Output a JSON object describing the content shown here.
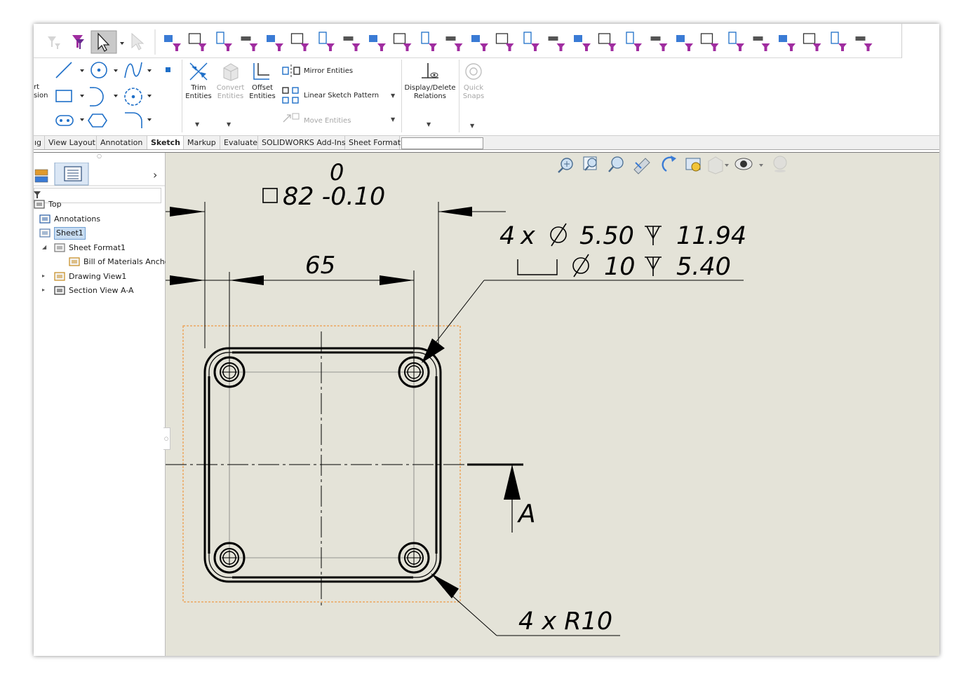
{
  "ribbon": {
    "left_partial_labels": [
      "rt",
      "sion"
    ],
    "trim_label": [
      "Trim",
      "Entities"
    ],
    "convert_label": [
      "Convert",
      "Entities"
    ],
    "offset_label": [
      "Offset",
      "Entities"
    ],
    "mirror_label": "Mirror Entities",
    "linear_pattern_label": "Linear Sketch Pattern",
    "move_label": "Move Entities",
    "relations_label": [
      "Display/Delete",
      "Relations"
    ],
    "quick_snaps_label": [
      "Quick",
      "Snaps"
    ]
  },
  "tabs": [
    {
      "label": "ıg",
      "active": false
    },
    {
      "label": "View Layout",
      "active": false
    },
    {
      "label": "Annotation",
      "active": false
    },
    {
      "label": "Sketch",
      "active": true
    },
    {
      "label": "Markup",
      "active": false
    },
    {
      "label": "Evaluate",
      "active": false
    },
    {
      "label": "SOLIDWORKS Add-Ins",
      "active": false
    },
    {
      "label": "Sheet Format",
      "active": false
    }
  ],
  "tree": {
    "items": [
      {
        "label": "Top",
        "icon": "drawing-icon"
      },
      {
        "label": "Annotations",
        "icon": "annotations-icon"
      },
      {
        "label": "Sheet1",
        "icon": "sheet-icon",
        "selected": true
      },
      {
        "label": "Sheet Format1",
        "icon": "sheet-format-icon",
        "expanded": true
      },
      {
        "label": "Bill of Materials Anchor",
        "icon": "bom-anchor-icon"
      },
      {
        "label": "Drawing View1",
        "icon": "drawing-view-icon",
        "expanded": false
      },
      {
        "label": "Section View A-A",
        "icon": "section-view-icon",
        "expanded": false
      }
    ],
    "expand_arrow": "›"
  },
  "drawing": {
    "dim_tolerance_upper": "0",
    "dim_overall": "82 -0.10",
    "dim_hole_spacing": "65",
    "hole_callout_count": "4",
    "hole_callout_x": "x",
    "hole_diameter": "5.50",
    "hole_depth": "11.94",
    "cbore_diameter": "10",
    "cbore_depth": "5.40",
    "section_label": "A",
    "fillet_callout": "4 x R10"
  },
  "colors": {
    "canvas": "#e4e3d8",
    "filter_funnel": "#a02da0",
    "accent_blue": "#1e6fc8",
    "selection_orange": "#f08a24"
  }
}
